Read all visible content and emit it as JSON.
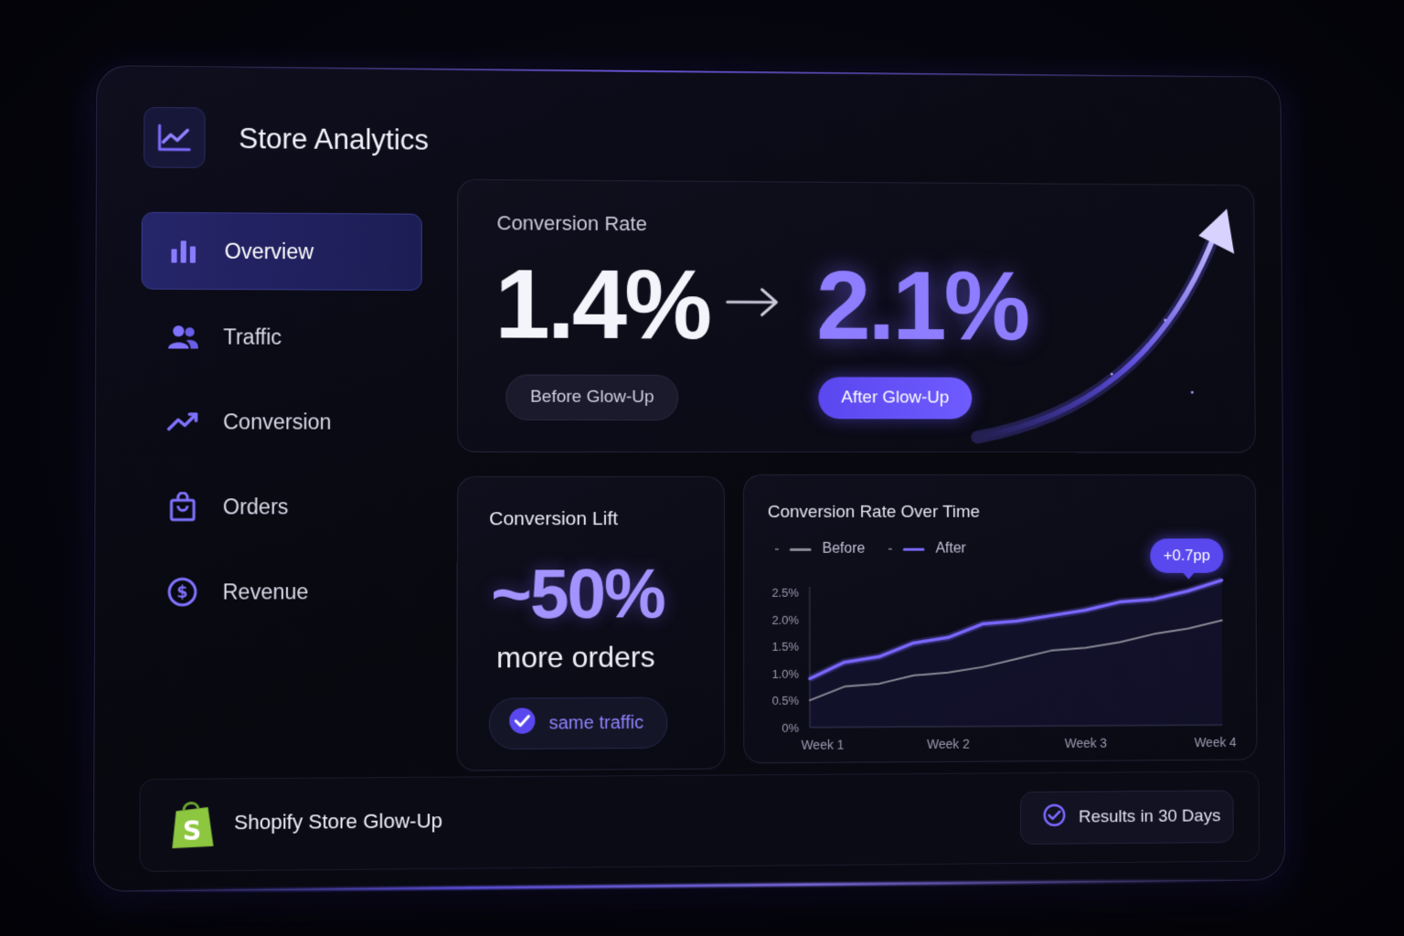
{
  "app": {
    "title": "Store Analytics",
    "logo_icon": "trend-chart-icon"
  },
  "sidebar": {
    "items": [
      {
        "label": "Overview",
        "icon": "bar-chart-icon",
        "active": true
      },
      {
        "label": "Traffic",
        "icon": "users-icon",
        "active": false
      },
      {
        "label": "Conversion",
        "icon": "trend-up-icon",
        "active": false
      },
      {
        "label": "Orders",
        "icon": "shopping-bag-icon",
        "active": false
      },
      {
        "label": "Revenue",
        "icon": "dollar-circle-icon",
        "active": false
      }
    ]
  },
  "conversion": {
    "title": "Conversion Rate",
    "before_value": "1.4%",
    "after_value": "2.1%",
    "before_label": "Before Glow-Up",
    "after_label": "After Glow-Up"
  },
  "lift": {
    "title": "Conversion Lift",
    "value": "~50%",
    "subtitle": "more orders",
    "pill": "same traffic"
  },
  "timechart": {
    "title": "Conversion Rate Over Time",
    "badge": "+0.7pp"
  },
  "footer": {
    "title": "Shopify Store Glow-Up",
    "results": "Results in 30 Days"
  },
  "colors": {
    "accent": "#6e5cff",
    "before_line": "#8a8a96",
    "after_line": "#7a68ff",
    "shopify_green": "#8dc63f"
  },
  "chart_data": {
    "type": "line",
    "title": "Conversion Rate Over Time",
    "xlabel": "",
    "ylabel": "",
    "x_ticks": [
      "Week 1",
      "Week 2",
      "Week 3",
      "Week 4"
    ],
    "y_ticks": [
      "0%",
      "0.5%",
      "1.0%",
      "1.5%",
      "2.0%",
      "2.5%"
    ],
    "ylim": [
      0,
      2.5
    ],
    "xlim": [
      1,
      4
    ],
    "legend_position": "top-left",
    "series": [
      {
        "name": "Before",
        "x": [
          1,
          1.25,
          1.5,
          1.75,
          2,
          2.25,
          2.5,
          2.75,
          3,
          3.25,
          3.5,
          3.75,
          4
        ],
        "values": [
          0.5,
          0.75,
          0.8,
          0.95,
          1.0,
          1.1,
          1.25,
          1.4,
          1.45,
          1.55,
          1.7,
          1.8,
          1.95
        ]
      },
      {
        "name": "After",
        "x": [
          1,
          1.25,
          1.5,
          1.75,
          2,
          2.25,
          2.5,
          2.75,
          3,
          3.25,
          3.5,
          3.75,
          4
        ],
        "values": [
          0.9,
          1.2,
          1.3,
          1.55,
          1.65,
          1.9,
          1.95,
          2.05,
          2.15,
          2.3,
          2.35,
          2.5,
          2.7
        ]
      }
    ]
  }
}
